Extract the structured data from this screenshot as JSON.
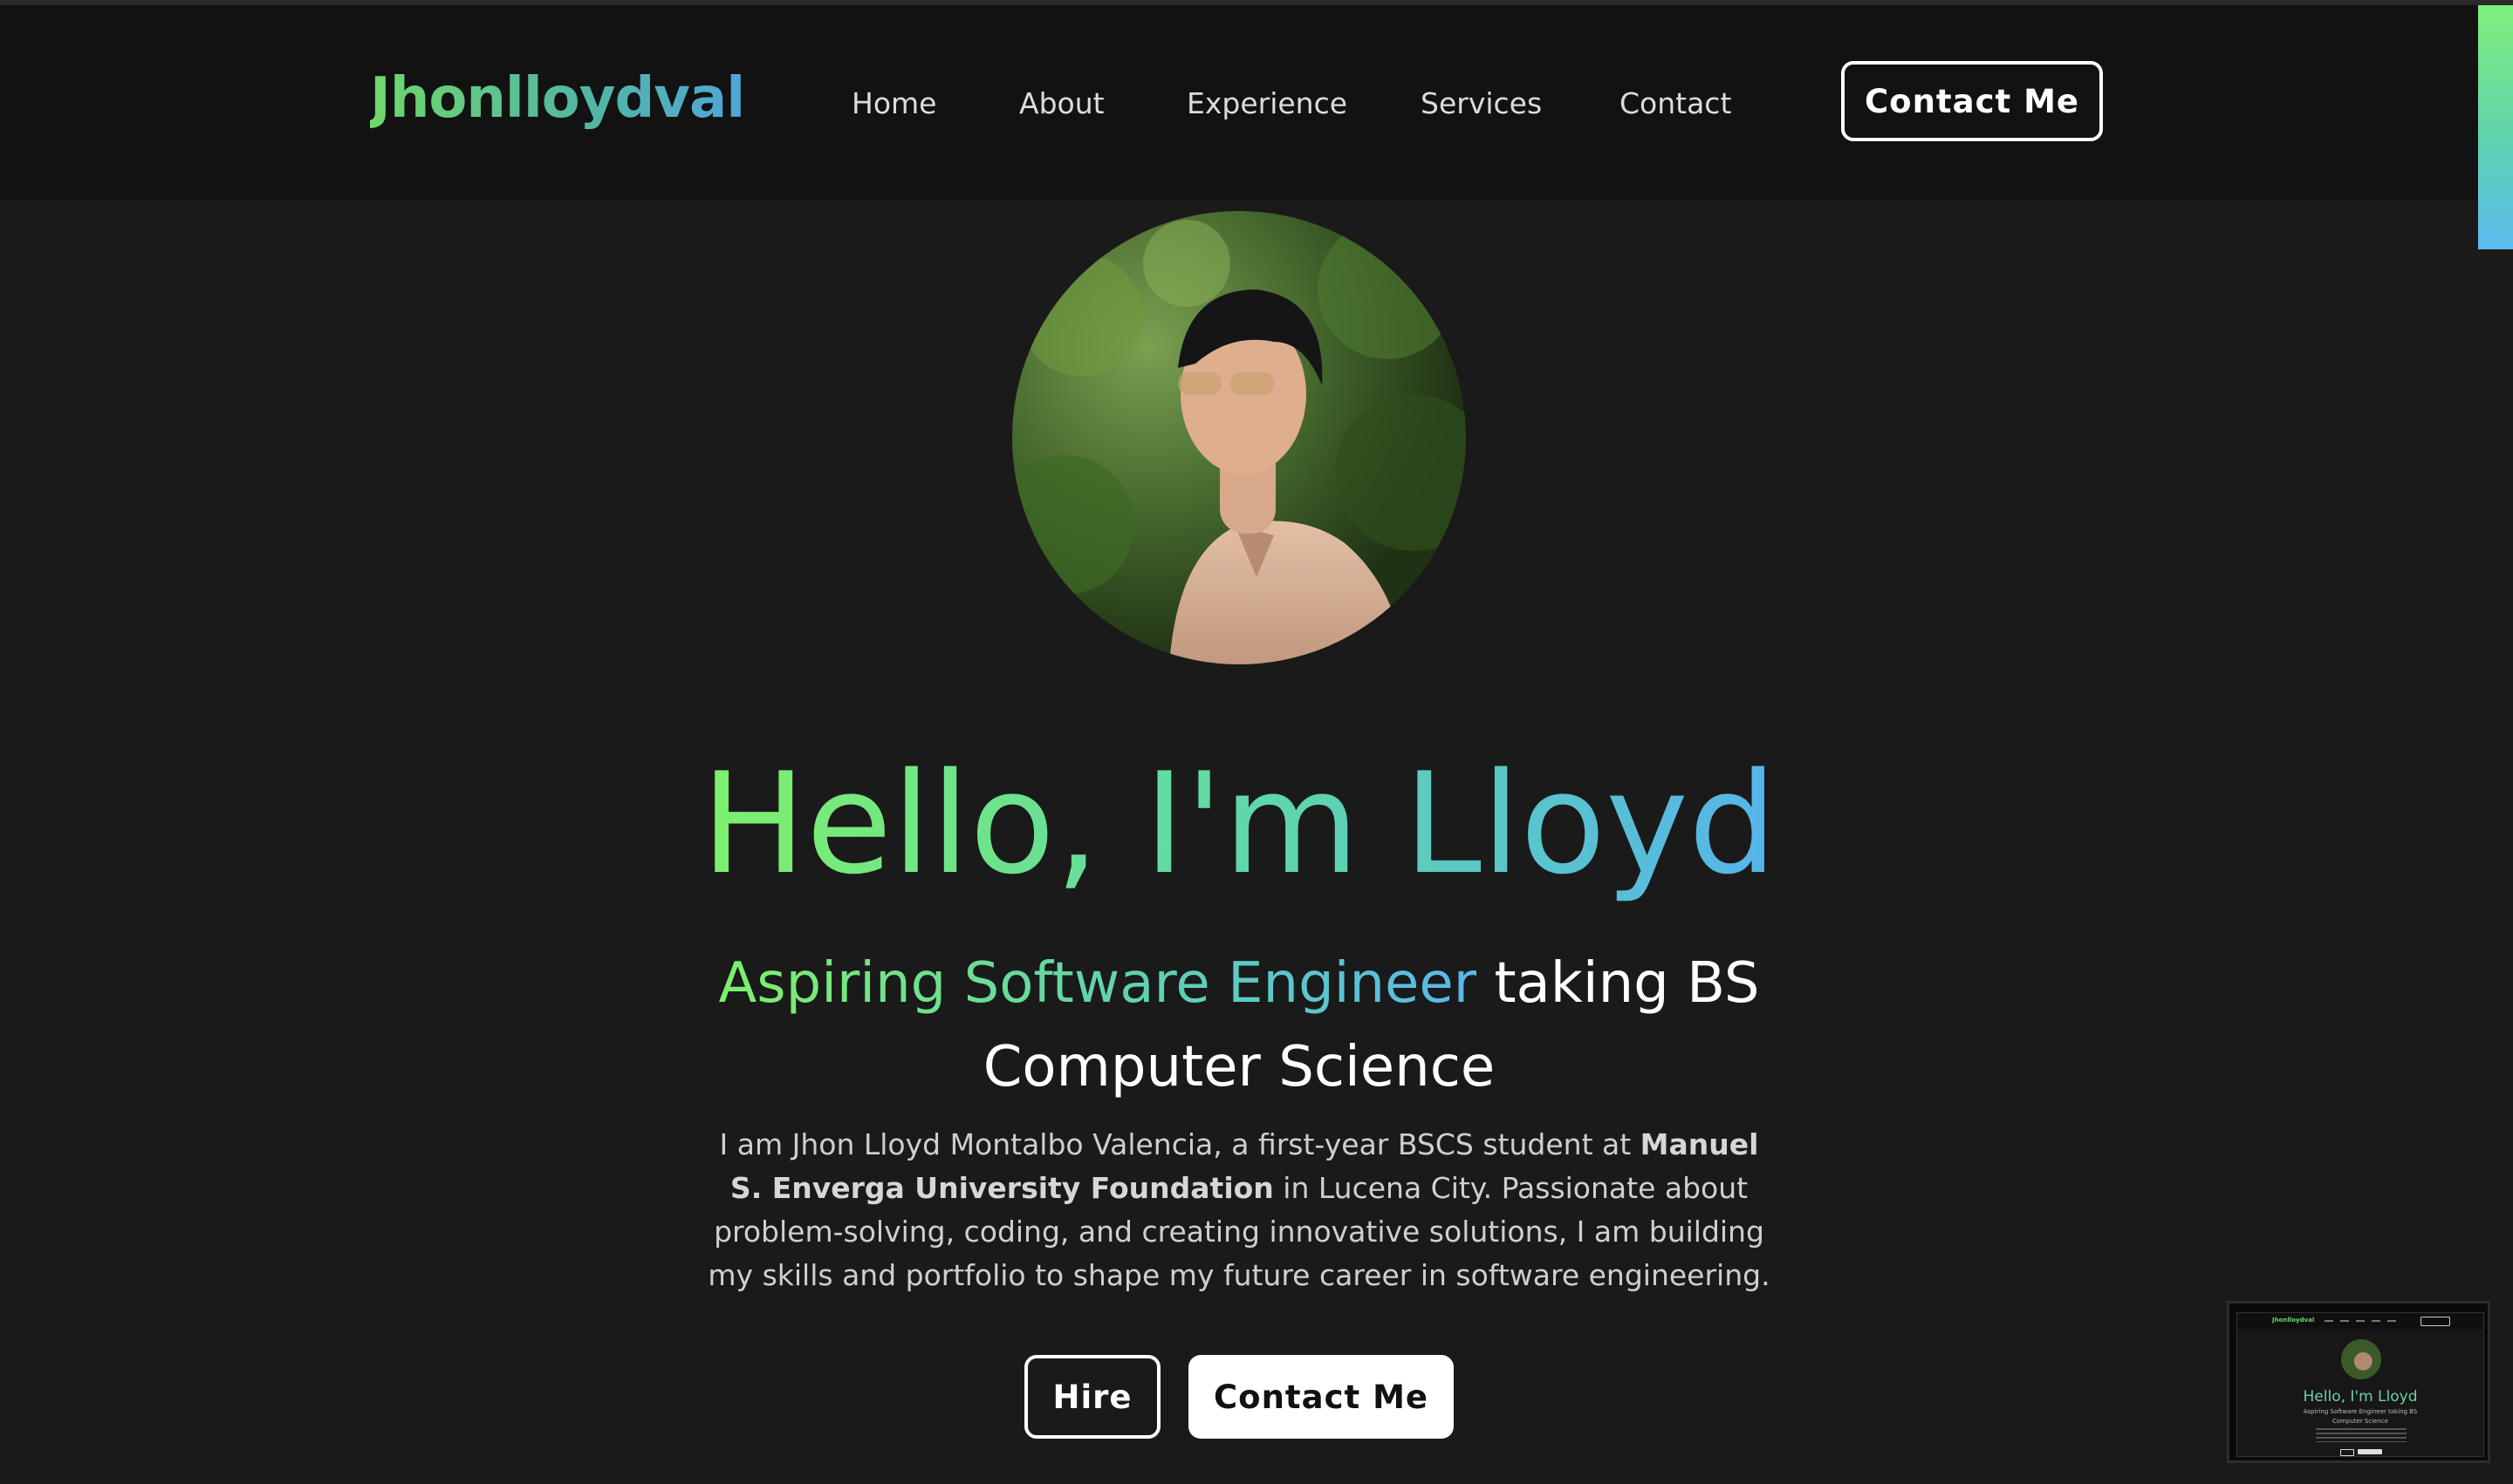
{
  "nav": {
    "logo": "Jhonlloydval",
    "links": [
      "Home",
      "About",
      "Experience",
      "Services",
      "Contact"
    ],
    "cta_label": "Contact Me"
  },
  "hero": {
    "title": "Hello, I'm Lloyd",
    "subtitle_highlight": "Aspiring Software Engineer",
    "subtitle_line1_rest": " taking BS",
    "subtitle_line2": "Computer Science",
    "bio_part1": "I am Jhon Lloyd Montalbo Valencia, a first-year BSCS student at ",
    "bio_bold": "Manuel S. Enverga University Foundation",
    "bio_part2": " in Lucena City. Passionate about problem-solving, coding, and creating innovative solutions, I am building my skills and portfolio to shape my future career in software engineering.",
    "hire_label": "Hire",
    "contact_label": "Contact Me"
  },
  "thumbnail": {
    "logo": "Jhonlloydval",
    "title": "Hello, I'm Lloyd",
    "subtitle_line1": "Aspiring Software Engineer taking BS",
    "subtitle_line2": "Computer Science"
  },
  "colors": {
    "background": "#1a1a1a",
    "navbar": "#121212",
    "gradient_start": "#7ef06c",
    "gradient_end": "#55b4ea",
    "text": "#ffffff",
    "muted_text": "#cfcfcf"
  }
}
